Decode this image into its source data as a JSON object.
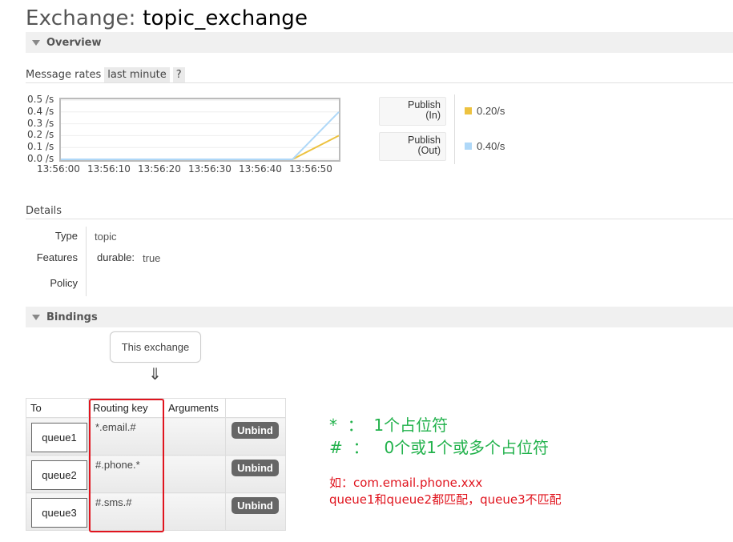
{
  "page": {
    "title_prefix": "Exchange: ",
    "title_name": "topic_exchange"
  },
  "overview": {
    "header": "Overview",
    "rate_label": "Message rates",
    "range_label": "last minute",
    "help_label": "?"
  },
  "chart_data": {
    "type": "line",
    "x": [
      "13:56:00",
      "13:56:10",
      "13:56:20",
      "13:56:30",
      "13:56:40",
      "13:56:50",
      "13:57:00"
    ],
    "ylim": [
      0,
      0.5
    ],
    "y_ticks": [
      "0.5 /s",
      "0.4 /s",
      "0.3 /s",
      "0.2 /s",
      "0.1 /s",
      "0.0 /s"
    ],
    "x_tick_labels": [
      "13:56:00",
      "13:56:10",
      "13:56:20",
      "13:56:30",
      "13:56:40",
      "13:56:50"
    ],
    "series": [
      {
        "name": "Publish (In)",
        "color": "#edc240",
        "values": [
          0,
          0,
          0,
          0,
          0,
          0,
          0.2
        ]
      },
      {
        "name": "Publish (Out)",
        "color": "#afd8f8",
        "values": [
          0,
          0,
          0,
          0,
          0,
          0,
          0.4
        ]
      }
    ],
    "grid": true
  },
  "legend": {
    "in": {
      "label_line1": "Publish",
      "label_line2": "(In)",
      "value": "0.20/s",
      "color": "#edc240"
    },
    "out": {
      "label_line1": "Publish",
      "label_line2": "(Out)",
      "value": "0.40/s",
      "color": "#afd8f8"
    }
  },
  "details": {
    "title": "Details",
    "type_key": "Type",
    "type_val": "topic",
    "features_key": "Features",
    "features_name": "durable:",
    "features_val": "true",
    "policy_key": "Policy"
  },
  "bindings": {
    "header": "Bindings",
    "this_exchange": "This exchange",
    "arrow": "⇓",
    "columns": [
      "To",
      "Routing key",
      "Arguments",
      ""
    ],
    "rows": [
      {
        "queue": "queue1",
        "key": "*.email.#",
        "action": "Unbind"
      },
      {
        "queue": "queue2",
        "key": "#.phone.*",
        "action": "Unbind"
      },
      {
        "queue": "queue3",
        "key": "#.sms.#",
        "action": "Unbind"
      }
    ]
  },
  "annotations": {
    "star": "*  ：  1个占位符",
    "hash": "#  ：   0个或1个或多个占位符",
    "example": "如：com.email.phone.xxx",
    "result": "queue1和queue2都匹配，queue3不匹配"
  }
}
